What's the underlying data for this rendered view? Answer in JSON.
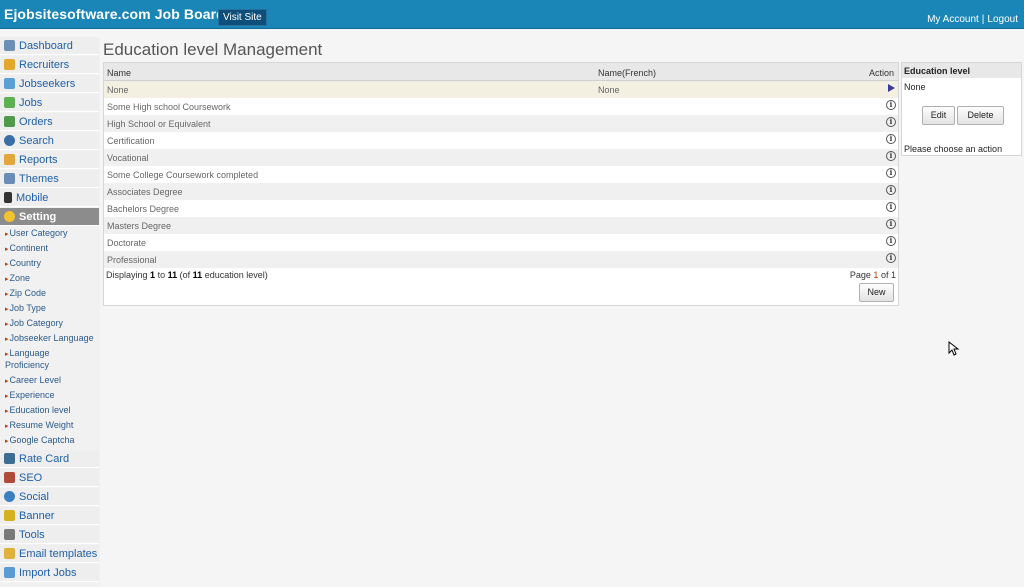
{
  "header": {
    "brand": "Ejobsitesoftware.com Job Board",
    "visit_site": "Visit Site",
    "my_account": "My Account",
    "separator": "|",
    "logout": "Logout",
    "bar_color": "#1a86b8"
  },
  "sidebar": {
    "top_items": [
      {
        "label": "Dashboard",
        "icon": "home-icon"
      },
      {
        "label": "Recruiters",
        "icon": "recruiter-icon"
      },
      {
        "label": "Jobseekers",
        "icon": "jobseekers-icon"
      },
      {
        "label": "Jobs",
        "icon": "jobs-icon"
      },
      {
        "label": "Orders",
        "icon": "orders-icon"
      },
      {
        "label": "Search",
        "icon": "search-icon"
      },
      {
        "label": "Reports",
        "icon": "reports-icon"
      },
      {
        "label": "Themes",
        "icon": "themes-icon"
      },
      {
        "label": "Mobile",
        "icon": "mobile-icon"
      },
      {
        "label": "Setting",
        "icon": "gear-icon",
        "active": true
      }
    ],
    "setting_sub_items": [
      "User Category",
      "Continent",
      "Country",
      "Zone",
      "Zip Code",
      "Job Type",
      "Job Category",
      "Jobseeker Language",
      "Language Proficiency",
      "Career Level",
      "Experience",
      "Education level",
      "Resume Weight",
      "Google Captcha"
    ],
    "bottom_items": [
      {
        "label": "Rate Card",
        "icon": "dollar-icon"
      },
      {
        "label": "SEO",
        "icon": "seo-icon"
      },
      {
        "label": "Social",
        "icon": "social-icon"
      },
      {
        "label": "Banner",
        "icon": "banner-icon"
      },
      {
        "label": "Tools",
        "icon": "tools-icon"
      },
      {
        "label": "Email templates",
        "icon": "email-icon"
      },
      {
        "label": "Import Jobs",
        "icon": "import-icon"
      }
    ]
  },
  "main": {
    "title": "Education level Management",
    "columns": {
      "name": "Name",
      "name_french": "Name(French)",
      "action": "Action"
    },
    "rows": [
      {
        "name": "None",
        "name_french": "None",
        "selected": true
      },
      {
        "name": "Some High school Coursework",
        "name_french": ""
      },
      {
        "name": "High School or Equivalent",
        "name_french": ""
      },
      {
        "name": "Certification",
        "name_french": ""
      },
      {
        "name": "Vocational",
        "name_french": ""
      },
      {
        "name": "Some College Coursework completed",
        "name_french": ""
      },
      {
        "name": "Associates Degree",
        "name_french": ""
      },
      {
        "name": "Bachelors Degree",
        "name_french": ""
      },
      {
        "name": "Masters Degree",
        "name_french": ""
      },
      {
        "name": "Doctorate",
        "name_french": ""
      },
      {
        "name": "Professional",
        "name_french": ""
      }
    ],
    "footer": {
      "displaying": "Displaying",
      "from": "1",
      "to_word": "to",
      "to": "11",
      "of_open": "(of",
      "total": "11",
      "of_close": "education level)",
      "page_word": "Page",
      "page": "1",
      "of_word": "of",
      "pages": "1"
    },
    "new_button": "New"
  },
  "panel": {
    "title": "Education level",
    "value": "None",
    "edit_button": "Edit",
    "delete_button": "Delete",
    "message": "Please choose an action"
  }
}
